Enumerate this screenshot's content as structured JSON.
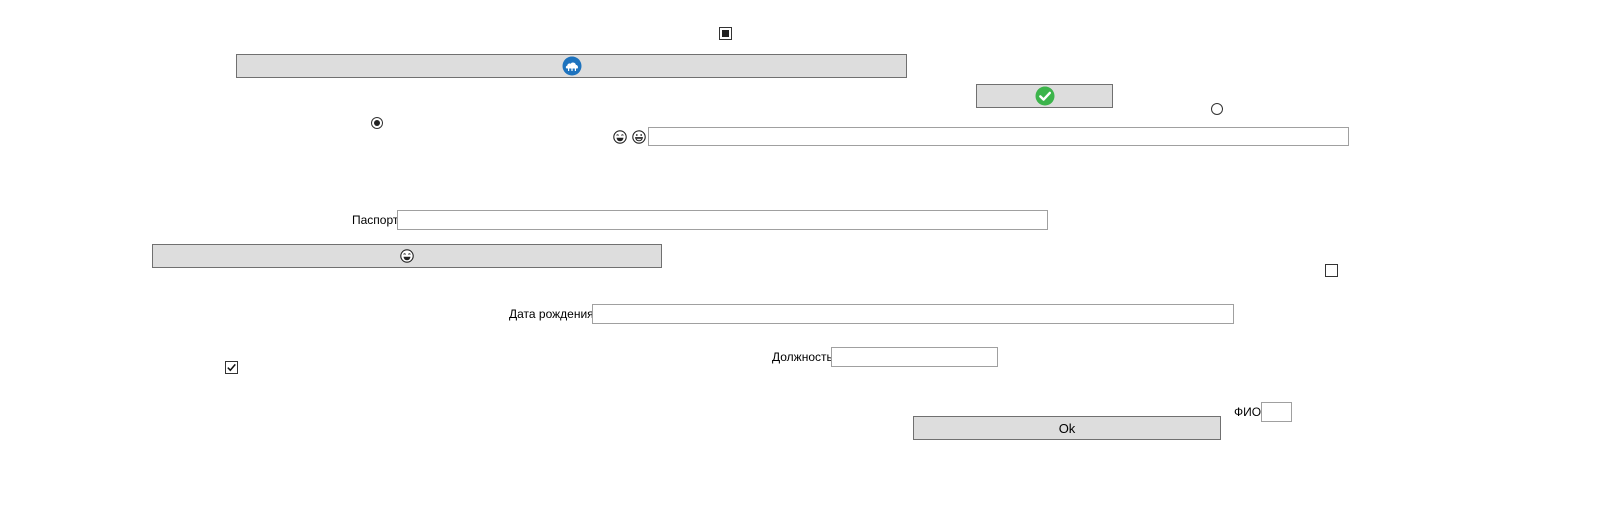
{
  "form": {
    "labels": {
      "passport": "Паспорт",
      "birth_date": "Дата рождения",
      "position": "Должность",
      "full_name": "ФИО"
    },
    "fields": {
      "top_text": "",
      "passport": "",
      "birth_date": "",
      "position": "",
      "full_name": ""
    },
    "buttons": {
      "ok_label": "Ok"
    },
    "checkboxes": {
      "top_checkbox_state": "indeterminate",
      "right_checkbox_state": "unchecked",
      "left_checkbox_state": "checked"
    },
    "radios": {
      "left_radio_state": "checked",
      "right_radio_state": "unchecked"
    },
    "icons": {
      "wide_button_icon": "cloud-app-icon",
      "check_button_icon": "green-check-icon",
      "emoji_one": "laughing-emoji-icon",
      "emoji_two": "grinning-emoji-icon",
      "lower_button_icon": "laughing-emoji-icon"
    },
    "colors": {
      "button_bg": "#dddddd",
      "button_border": "#707070",
      "field_border": "#a0a0a0",
      "accent_blue": "#1e73be",
      "accent_green": "#3cb44b"
    }
  }
}
